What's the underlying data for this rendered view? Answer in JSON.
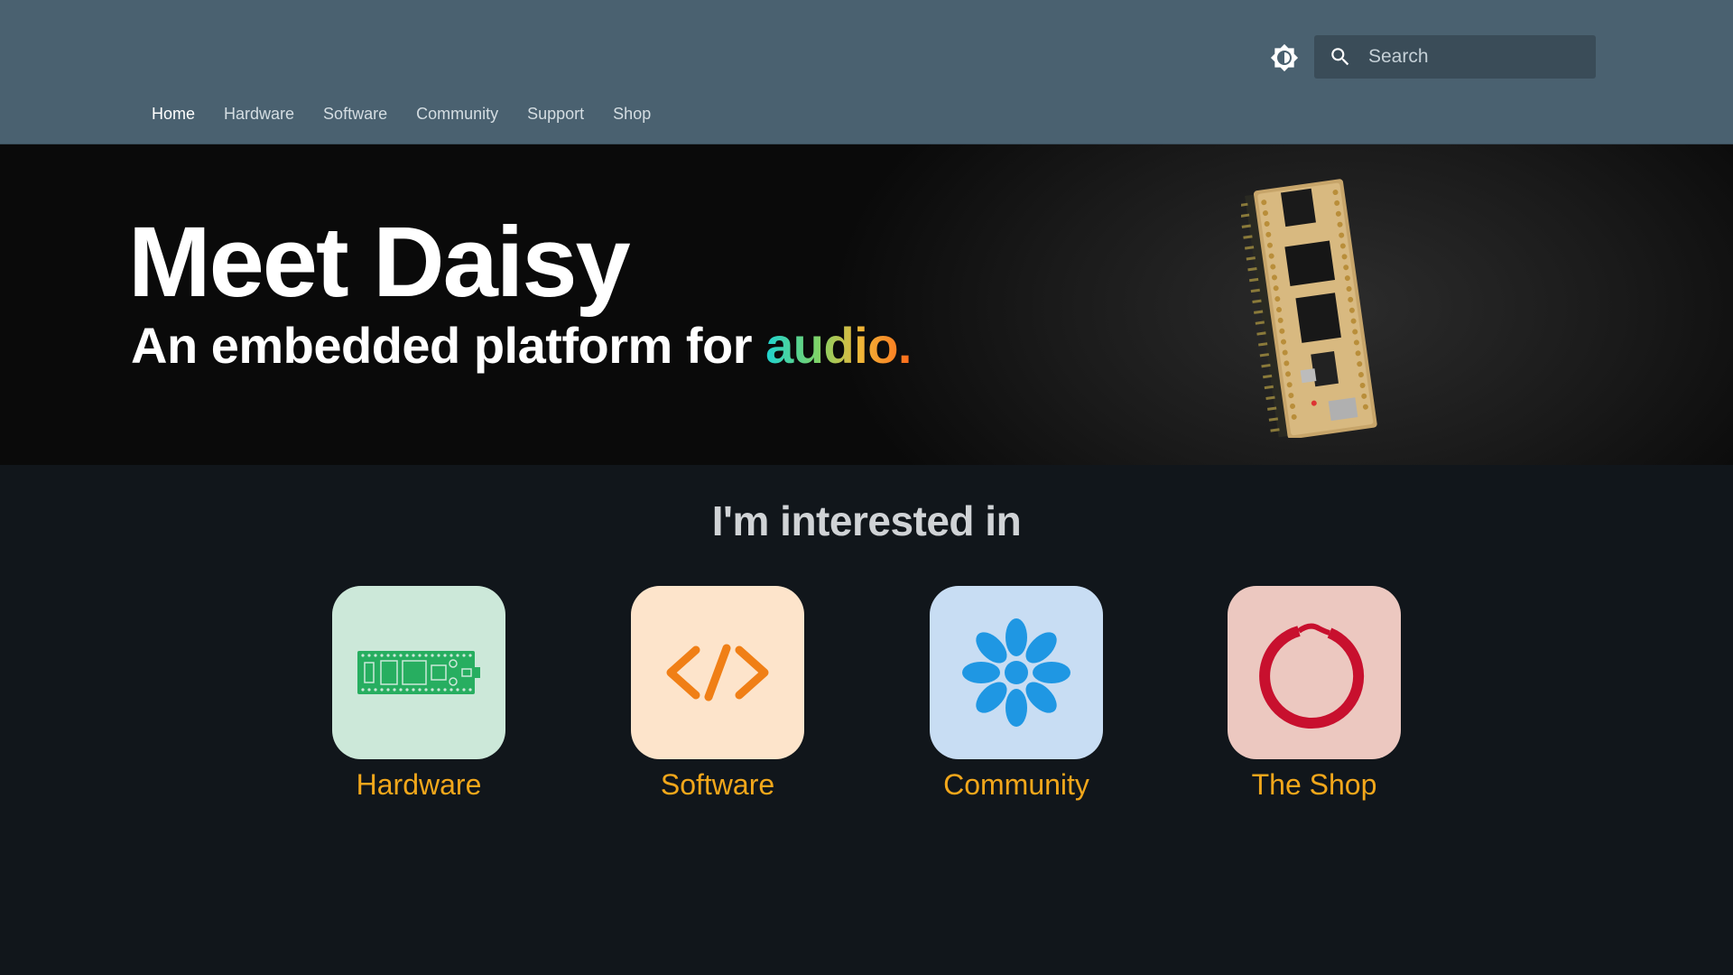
{
  "header": {
    "theme_toggle_icon": "brightness-icon",
    "search": {
      "placeholder": "Search",
      "icon": "search-icon"
    },
    "nav": [
      {
        "label": "Home",
        "active": true
      },
      {
        "label": "Hardware"
      },
      {
        "label": "Software"
      },
      {
        "label": "Community"
      },
      {
        "label": "Support"
      },
      {
        "label": "Shop"
      }
    ]
  },
  "hero": {
    "title": "Meet Daisy",
    "subtitle_prefix": "An embedded platform for ",
    "subtitle_highlight": "audio.",
    "image": "daisy-seed-board"
  },
  "interests": {
    "title": "I'm interested in",
    "cards": [
      {
        "label": "Hardware",
        "icon": "circuit-board-icon",
        "bg": "#cce8d9",
        "color": "#27ae60"
      },
      {
        "label": "Software",
        "icon": "code-icon",
        "bg": "#fde4cb",
        "color": "#f07f16"
      },
      {
        "label": "Community",
        "icon": "flower-icon",
        "bg": "#c8ddf3",
        "color": "#1f97e3"
      },
      {
        "label": "The Shop",
        "icon": "shop-ring-icon",
        "bg": "#ecc8c0",
        "color": "#c8102e"
      }
    ]
  },
  "colors": {
    "header_bg": "#4a6170",
    "page_bg": "#11161b",
    "accent_label": "#f2a71b"
  }
}
